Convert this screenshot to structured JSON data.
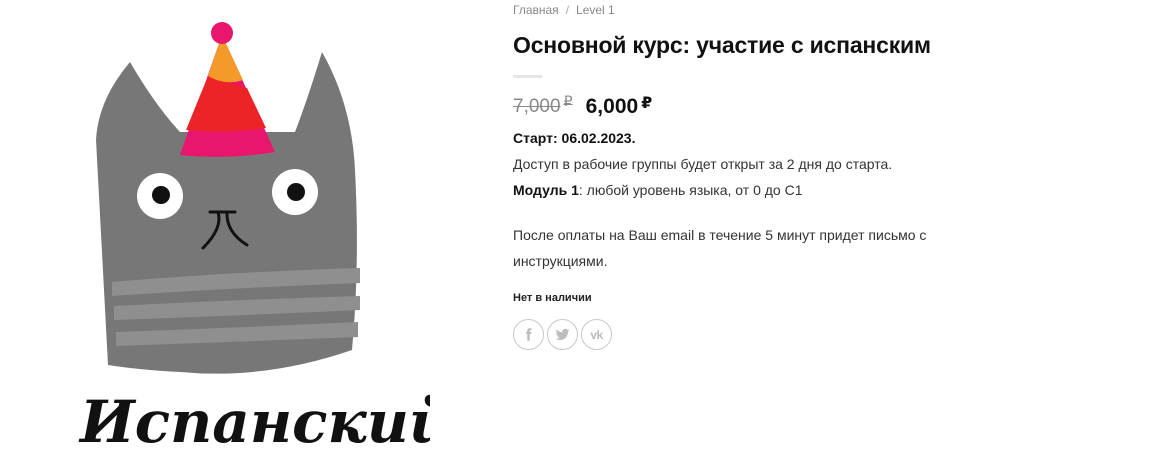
{
  "breadcrumb": {
    "home": "Главная",
    "separator": "/",
    "current": "Level 1"
  },
  "product": {
    "title": "Основной курс: участие с испанским",
    "old_price": "7,000",
    "new_price": "6,000",
    "currency": "₽",
    "start_label": "Старт: 06.02.2023.",
    "access_text": "Доступ в рабочие группы будет открыт за 2 дня до старта.",
    "module_label": "Модуль 1",
    "module_text": ": любой уровень языка, от 0 до С1",
    "email_text": "После оплаты на Ваш email в течение 5 минут придет письмо с инструкциями.",
    "stock_status": "Нет в наличии"
  },
  "share": [
    {
      "name": "share-facebook",
      "icon": "facebook-icon"
    },
    {
      "name": "share-twitter",
      "icon": "twitter-icon"
    },
    {
      "name": "share-vk",
      "icon": "vk-icon",
      "label": "vk"
    }
  ],
  "image": {
    "logo_text": "Испанский",
    "colors": {
      "cat": "#777778",
      "stripes": "#8f8f90",
      "hat_orange": "#f39a2a",
      "hat_red": "#ec2327",
      "hat_pink": "#e8166d"
    }
  }
}
